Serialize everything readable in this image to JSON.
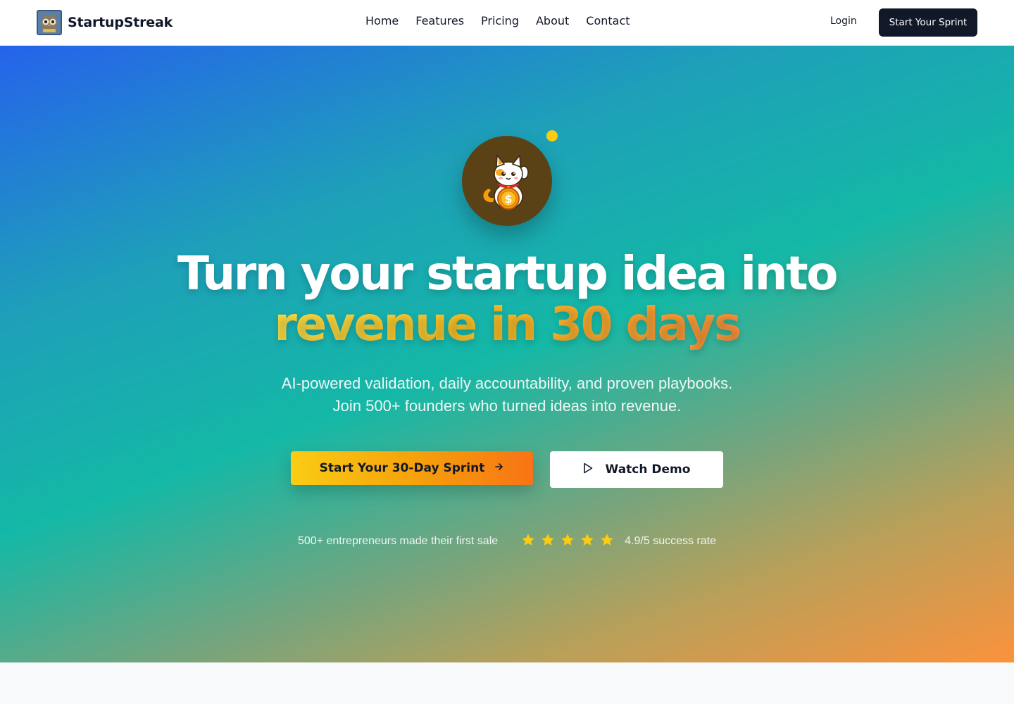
{
  "header": {
    "brand_name": "StartupStreak",
    "nav": [
      "Home",
      "Features",
      "Pricing",
      "About",
      "Contact"
    ],
    "login_label": "Login",
    "cta_label": "Start Your Sprint"
  },
  "hero": {
    "headline_line1": "Turn your startup idea into",
    "headline_line2": "revenue in 30 days",
    "subhead_line1": "AI-powered validation, daily accountability, and proven playbooks.",
    "subhead_line2": "Join 500+ founders who turned ideas into revenue.",
    "primary_cta": "Start Your 30-Day Sprint",
    "secondary_cta": "Watch Demo",
    "proof_text": "500+ entrepreneurs made their first sale",
    "rating_stars": 5,
    "rating_text": "4.9/5 success rate"
  },
  "icons": {
    "brand_logo": "owl-logo",
    "mascot": "lucky-cat-icon",
    "arrow": "arrow-right-icon",
    "play": "play-icon",
    "star": "star-icon"
  },
  "colors": {
    "header_cta_bg": "#111827",
    "accent_yellow": "#facc15",
    "accent_orange": "#f97316",
    "gradient_start": "#2563eb",
    "gradient_mid": "#14b8a6",
    "gradient_end": "#fb923c",
    "star": "#facc15"
  }
}
